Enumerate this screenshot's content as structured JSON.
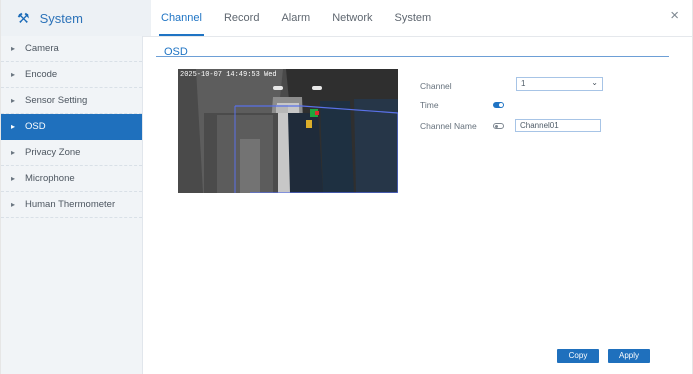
{
  "app": {
    "title": "System",
    "icon_name": "tools-icon",
    "close_label": "×"
  },
  "tabs": [
    {
      "label": "Channel",
      "active": true
    },
    {
      "label": "Record",
      "active": false
    },
    {
      "label": "Alarm",
      "active": false
    },
    {
      "label": "Network",
      "active": false
    },
    {
      "label": "System",
      "active": false
    }
  ],
  "sidebar": {
    "items": [
      {
        "label": "Camera",
        "active": false
      },
      {
        "label": "Encode",
        "active": false
      },
      {
        "label": "Sensor Setting",
        "active": false
      },
      {
        "label": "OSD",
        "active": true
      },
      {
        "label": "Privacy Zone",
        "active": false
      },
      {
        "label": "Microphone",
        "active": false
      },
      {
        "label": "Human Thermometer",
        "active": false
      }
    ]
  },
  "main": {
    "section_tab": "OSD",
    "preview": {
      "osd_text": "2025-10-07 14:49:53 Wed"
    },
    "form": {
      "channel_label": "Channel",
      "channel_value": "1",
      "time_label": "Time",
      "time_enabled": true,
      "channel_name_label": "Channel Name",
      "channel_name_enabled": false,
      "channel_name_value": "Channel01"
    },
    "buttons": {
      "copy": "Copy",
      "apply": "Apply"
    }
  },
  "colors": {
    "accent": "#1f74c4",
    "sidebar_bg": "#f1f4f7",
    "active_item": "#1f70bd"
  }
}
